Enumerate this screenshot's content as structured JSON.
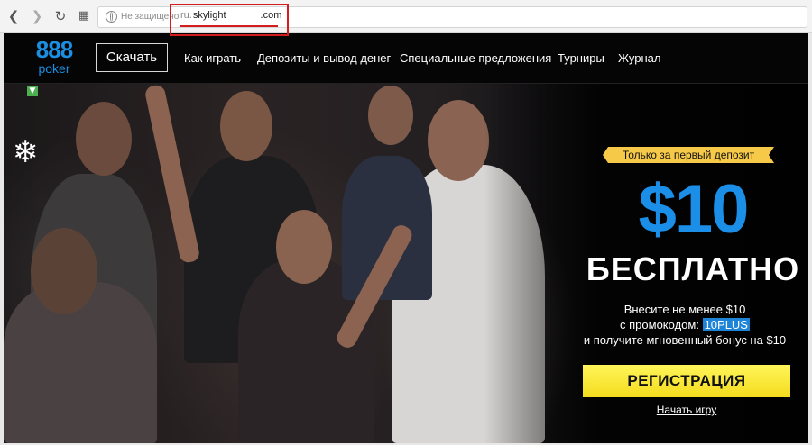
{
  "browser": {
    "insecure_label": "Не защищено",
    "url_subdomain": "ru.",
    "url_domain": "skylight",
    "url_tld": ".com"
  },
  "site": {
    "logo_number": "888",
    "logo_word": "poker",
    "download_label": "Скачать",
    "nav": [
      "Как играть",
      "Депозиты и вывод денег",
      "Специальные предложения",
      "Турниры",
      "Журнал"
    ]
  },
  "promo": {
    "ribbon": "Только за первый депозит",
    "amount": "$10",
    "headline": "БЕСПЛАТНО",
    "line1": "Внесите не менее $10",
    "line2_prefix": "с промокодом: ",
    "promo_code": "10PLUS",
    "line3": "и получите мгновенный бонус на $10",
    "register_label": "РЕГИСТРАЦИЯ",
    "start_label": "Начать игру"
  },
  "colors": {
    "brand_blue": "#1a8fe3",
    "cta_yellow": "#f4dc1d",
    "ribbon_gold": "#f7c948",
    "highlight_red": "#d41c1c"
  }
}
